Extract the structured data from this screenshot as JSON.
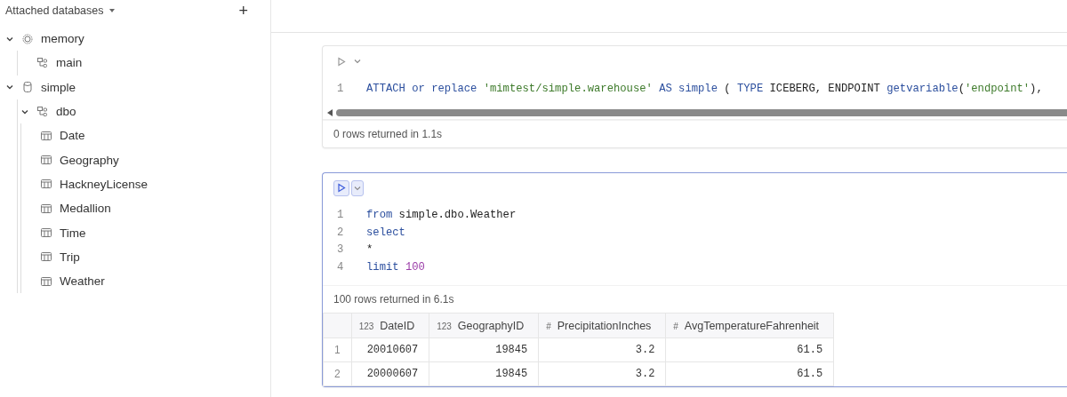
{
  "sidebar": {
    "title": "Attached databases",
    "add_label": "+",
    "tree": [
      {
        "label": "memory",
        "kind": "memory",
        "expanded": true,
        "children": [
          {
            "label": "main",
            "kind": "schema"
          }
        ]
      },
      {
        "label": "simple",
        "kind": "database",
        "expanded": true,
        "children": [
          {
            "label": "dbo",
            "kind": "schema",
            "expanded": true,
            "children": [
              {
                "label": "Date",
                "kind": "table"
              },
              {
                "label": "Geography",
                "kind": "table"
              },
              {
                "label": "HackneyLicense",
                "kind": "table"
              },
              {
                "label": "Medallion",
                "kind": "table"
              },
              {
                "label": "Time",
                "kind": "table"
              },
              {
                "label": "Trip",
                "kind": "table"
              },
              {
                "label": "Weather",
                "kind": "table"
              }
            ]
          }
        ]
      }
    ]
  },
  "cells": [
    {
      "selected": false,
      "scrollbar": true,
      "lines": [
        {
          "number": "1",
          "tokens": [
            {
              "kind": "keyword",
              "text": "ATTACH"
            },
            {
              "kind": "keyword",
              "text": " or"
            },
            {
              "kind": "keyword",
              "text": " replace"
            },
            {
              "kind": "string",
              "text": " 'mimtest/simple.warehouse'"
            },
            {
              "kind": "keyword",
              "text": " AS"
            },
            {
              "kind": "keyword",
              "text": " simple"
            },
            {
              "kind": "plain",
              "text": " ( "
            },
            {
              "kind": "keyword",
              "text": "TYPE"
            },
            {
              "kind": "plain",
              "text": " ICEBERG, ENDPOINT "
            },
            {
              "kind": "keyword",
              "text": "getvariable"
            },
            {
              "kind": "plain",
              "text": "("
            },
            {
              "kind": "string",
              "text": "'endpoint'"
            },
            {
              "kind": "plain",
              "text": "),"
            }
          ]
        }
      ],
      "status": "0 rows returned in 1.1s"
    },
    {
      "selected": true,
      "scrollbar": false,
      "lines": [
        {
          "number": "1",
          "tokens": [
            {
              "kind": "keyword",
              "text": "from"
            },
            {
              "kind": "plain",
              "text": " simple.dbo.Weather"
            }
          ]
        },
        {
          "number": "2",
          "tokens": [
            {
              "kind": "keyword",
              "text": "select"
            }
          ]
        },
        {
          "number": "3",
          "tokens": [
            {
              "kind": "plain",
              "text": "*"
            }
          ]
        },
        {
          "number": "4",
          "tokens": [
            {
              "kind": "keyword",
              "text": "limit"
            },
            {
              "kind": "number",
              "text": " 100"
            }
          ]
        }
      ],
      "status": "100 rows returned in 6.1s",
      "result": {
        "columns": [
          {
            "type_label": "123",
            "name": "DateID"
          },
          {
            "type_label": "123",
            "name": "GeographyID"
          },
          {
            "type_label": "#",
            "name": "PrecipitationInches"
          },
          {
            "type_label": "#",
            "name": "AvgTemperatureFahrenheit"
          }
        ],
        "rows": [
          {
            "number": "1",
            "values": [
              "20010607",
              "19845",
              "3.2",
              "61.5"
            ]
          },
          {
            "number": "2",
            "values": [
              "20000607",
              "19845",
              "3.2",
              "61.5"
            ]
          }
        ]
      }
    }
  ]
}
